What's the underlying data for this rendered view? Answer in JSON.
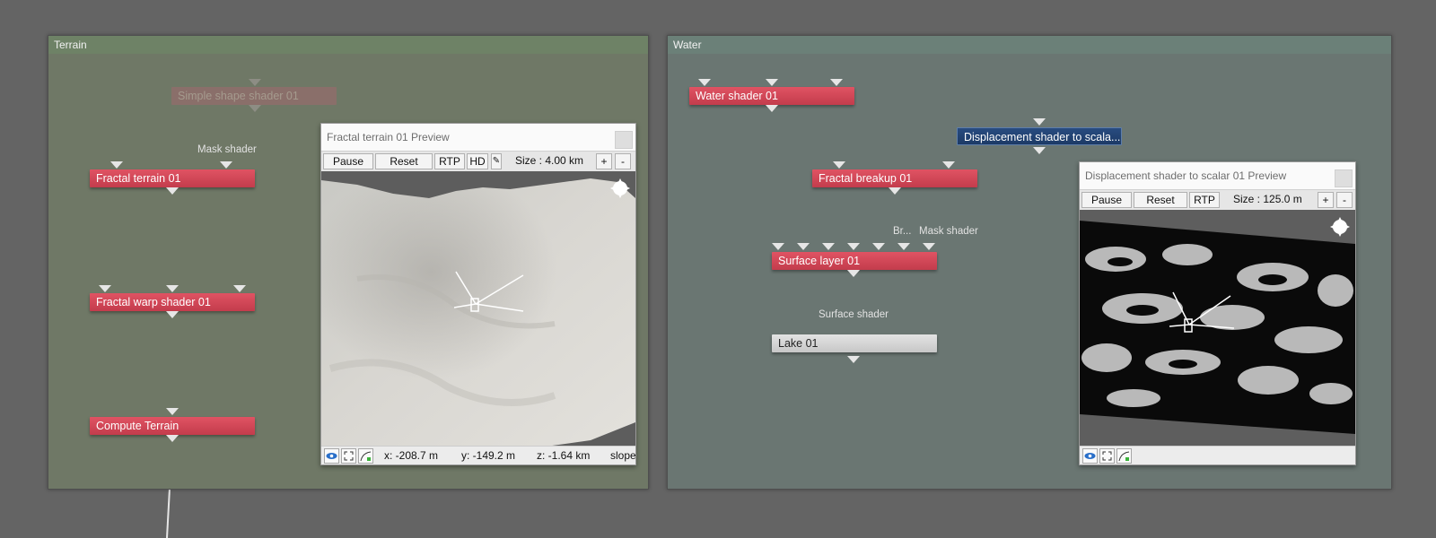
{
  "terrain_group": {
    "title": "Terrain",
    "nodes": {
      "simple_shape": "Simple shape shader 01",
      "fractal_terrain": "Fractal terrain 01",
      "fractal_warp": "Fractal warp shader 01",
      "compute_terrain": "Compute Terrain"
    },
    "labels": {
      "mask_shader": "Mask shader"
    }
  },
  "terrain_preview": {
    "title": "Fractal terrain 01 Preview",
    "toolbar": {
      "pause": "Pause",
      "reset": "Reset",
      "rtp": "RTP",
      "hd": "HD",
      "size": "Size :  4.00 km",
      "plus": "+",
      "minus": "-"
    },
    "status": {
      "x": "x: -208.7 m",
      "y": "y: -149.2 m",
      "z": "z: -1.64 km",
      "slope": "slope"
    }
  },
  "water_group": {
    "title": "Water",
    "nodes": {
      "water_shader": "Water shader 01",
      "displacement": "Displacement shader to scala...",
      "fractal_breakup": "Fractal breakup 01",
      "surface_layer": "Surface layer 01",
      "lake": "Lake 01"
    },
    "labels": {
      "breakup_trunc": "Br...",
      "mask_shader": "Mask shader",
      "surface_shader": "Surface shader"
    }
  },
  "water_preview": {
    "title": "Displacement shader to scalar 01 Preview",
    "toolbar": {
      "pause": "Pause",
      "reset": "Reset",
      "rtp": "RTP",
      "size": "Size :  125.0 m",
      "plus": "+",
      "minus": "-"
    }
  },
  "colors": {
    "node_red": "#d04655",
    "node_blue": "#1f4170",
    "node_gray": "#d4d4d4",
    "background": "#646464",
    "terrain_group": "#6f7866",
    "water_group": "#6a7672"
  },
  "icons": [
    "eye-icon",
    "fullscreen-icon",
    "render-icon",
    "compass-icon",
    "paintbrush-icon"
  ]
}
